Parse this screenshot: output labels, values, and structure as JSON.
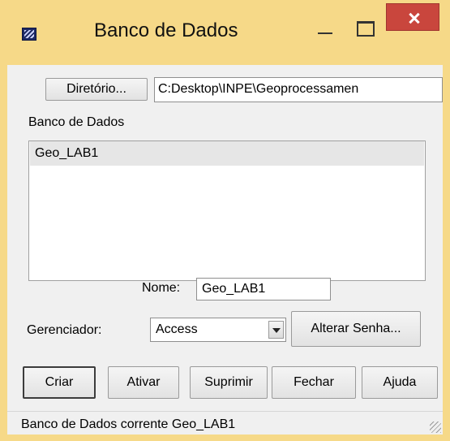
{
  "window": {
    "title": "Banco de Dados",
    "colors": {
      "frame": "#f6d988",
      "close": "#c9463d",
      "client": "#f0f0f0"
    }
  },
  "directory": {
    "button_label": "Diretório...",
    "path": "C:Desktop\\INPE\\Geoprocessamen"
  },
  "database": {
    "label": "Banco de Dados",
    "items": [
      "Geo_LAB1"
    ]
  },
  "name": {
    "label": "Nome:",
    "value": "Geo_LAB1"
  },
  "manager": {
    "label": "Gerenciador:",
    "selected": "Access",
    "change_password_label": "Alterar Senha..."
  },
  "actions": {
    "create": "Criar",
    "activate": "Ativar",
    "delete": "Suprimir",
    "close": "Fechar",
    "help": "Ajuda"
  },
  "status": {
    "text": "Banco de Dados corrente Geo_LAB1"
  },
  "icons": [
    "app-icon",
    "minimize-icon",
    "maximize-icon",
    "close-icon",
    "dropdown-arrow-icon",
    "resize-grip-icon"
  ]
}
